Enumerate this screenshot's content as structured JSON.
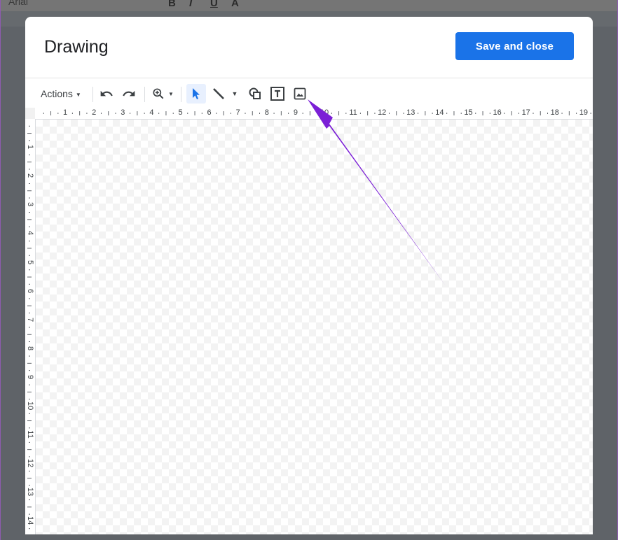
{
  "background_doc": {
    "font_name": "Arial"
  },
  "dialog": {
    "title": "Drawing",
    "save_button_label": "Save and close"
  },
  "toolbar": {
    "actions_label": "Actions",
    "items": [
      {
        "name": "undo-icon"
      },
      {
        "name": "redo-icon"
      },
      {
        "name": "zoom-icon"
      },
      {
        "name": "select-arrow-icon"
      },
      {
        "name": "line-icon"
      },
      {
        "name": "shape-icon"
      },
      {
        "name": "text-box-icon"
      },
      {
        "name": "image-icon"
      }
    ]
  },
  "ruler": {
    "horizontal": [
      "1",
      "2",
      "3",
      "4",
      "5",
      "6",
      "7",
      "8",
      "9",
      "10",
      "11",
      "12",
      "13",
      "14",
      "15",
      "16",
      "17",
      "18",
      "19"
    ],
    "vertical": [
      "1",
      "2",
      "3",
      "4",
      "5",
      "6",
      "7",
      "8",
      "9",
      "10",
      "11",
      "12",
      "13",
      "14"
    ]
  },
  "annotation": {
    "arrow_color": "#7b1fd6"
  },
  "colors": {
    "primary_button": "#1a73e8",
    "backdrop": "#5f6368"
  }
}
